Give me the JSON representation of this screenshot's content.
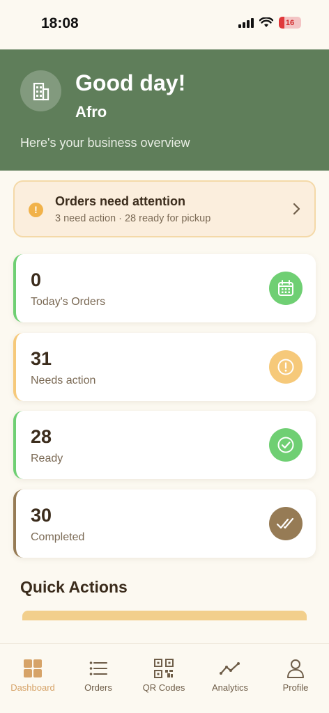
{
  "status_bar": {
    "time": "18:08",
    "battery": "16",
    "icons": [
      "signal-icon",
      "wifi-icon",
      "battery-icon"
    ]
  },
  "header": {
    "greeting": "Good day!",
    "business_name": "Afro",
    "subtitle": "Here's your business overview",
    "avatar_icon": "building-icon",
    "background_color": "#5f7e5a"
  },
  "alert": {
    "title": "Orders need attention",
    "subtitle": "3 need action · 28 ready for pickup",
    "icon": "exclamation-icon",
    "accent_color": "#f1b24a"
  },
  "stats": [
    {
      "value": "0",
      "label": "Today's Orders",
      "icon": "calendar-icon",
      "color": "#6fcf73"
    },
    {
      "value": "31",
      "label": "Needs action",
      "icon": "alert-circle-icon",
      "color": "#f6c97a"
    },
    {
      "value": "28",
      "label": "Ready",
      "icon": "check-circle-icon",
      "color": "#6fcf73"
    },
    {
      "value": "30",
      "label": "Completed",
      "icon": "double-check-icon",
      "color": "#967b55"
    }
  ],
  "quick_actions": {
    "title": "Quick Actions"
  },
  "tabs": [
    {
      "label": "Dashboard",
      "icon": "grid-icon",
      "active": true
    },
    {
      "label": "Orders",
      "icon": "list-icon",
      "active": false
    },
    {
      "label": "QR Codes",
      "icon": "qr-code-icon",
      "active": false
    },
    {
      "label": "Analytics",
      "icon": "chart-line-icon",
      "active": false
    },
    {
      "label": "Profile",
      "icon": "person-icon",
      "active": false
    }
  ]
}
